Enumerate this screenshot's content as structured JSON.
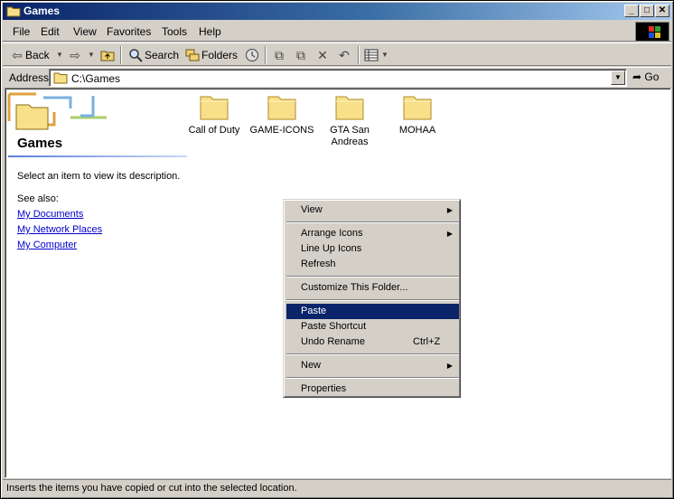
{
  "window": {
    "title": "Games"
  },
  "menubar": {
    "items": [
      "File",
      "Edit",
      "View",
      "Favorites",
      "Tools",
      "Help"
    ]
  },
  "toolbar": {
    "back_label": "Back",
    "search_label": "Search",
    "folders_label": "Folders"
  },
  "address": {
    "label": "Address",
    "value": "C:\\Games",
    "go_label": "Go"
  },
  "info_pane": {
    "folder_title": "Games",
    "description": "Select an item to view its description.",
    "see_also_label": "See also:",
    "links": [
      "My Documents",
      "My Network Places",
      "My Computer"
    ]
  },
  "files": [
    {
      "name": "Call of Duty"
    },
    {
      "name": "GAME-ICONS"
    },
    {
      "name": "GTA San Andreas"
    },
    {
      "name": "MOHAA"
    }
  ],
  "context_menu": {
    "view": "View",
    "arrange_icons": "Arrange Icons",
    "line_up_icons": "Line Up Icons",
    "refresh": "Refresh",
    "customize": "Customize This Folder...",
    "paste": "Paste",
    "paste_shortcut": "Paste Shortcut",
    "undo_rename": "Undo Rename",
    "undo_shortcut": "Ctrl+Z",
    "new": "New",
    "properties": "Properties",
    "highlighted": "Paste"
  },
  "statusbar": {
    "text": "Inserts the items you have copied or cut into the selected location."
  },
  "colors": {
    "title_active": "#0a246a",
    "menu_highlight": "#0a246a",
    "face": "#d4d0c8",
    "link": "#0000cc"
  }
}
